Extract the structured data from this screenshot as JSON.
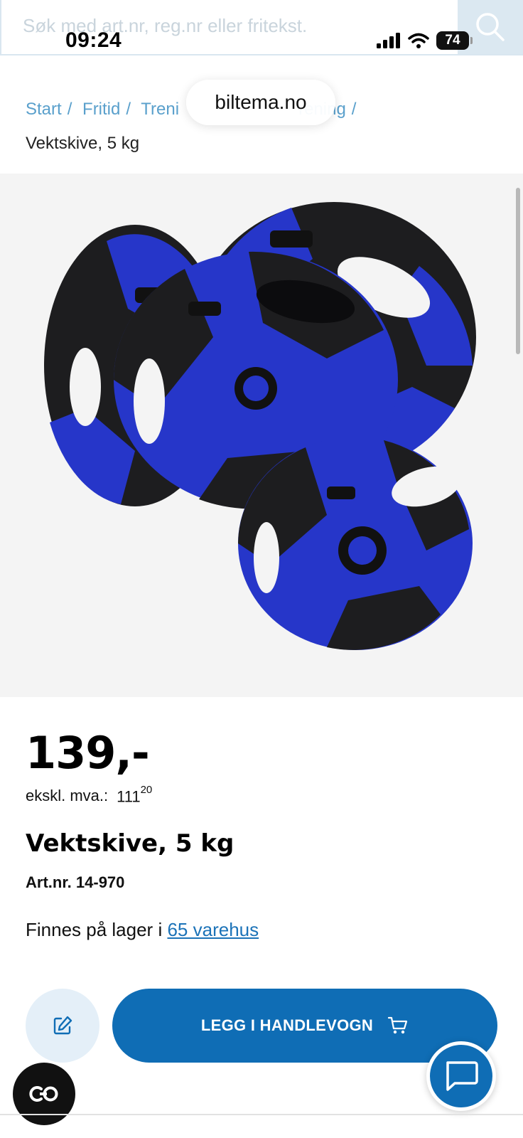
{
  "status_bar": {
    "time": "09:24",
    "battery": "74"
  },
  "search": {
    "placeholder": "Søk med art.nr, reg.nr eller fritekst."
  },
  "browser": {
    "domain": "biltema.no"
  },
  "breadcrumb": {
    "items": [
      {
        "label": "Start"
      },
      {
        "label": "Fritid"
      },
      {
        "label": "Treni"
      },
      {
        "label": "rening"
      }
    ],
    "current": "Vektskive, 5 kg"
  },
  "product": {
    "price": "139,-",
    "ex_vat_label": "ekskl. mva.:",
    "ex_vat_whole": "111",
    "ex_vat_decimals": "20",
    "name": "Vektskive, 5 kg",
    "art_nr": "Art.nr. 14-970",
    "stock_text": "Finnes på lager i",
    "stock_link": "65 varehus"
  },
  "actions": {
    "add_to_cart_label": "LEGG I HANDLEVOGN"
  },
  "colors": {
    "primary": "#0f6db5",
    "link": "#5aa0cc",
    "plate_blue": "#2636c9",
    "plate_black": "#1d1d1f"
  },
  "icons": {
    "search": "search-icon",
    "note": "edit-icon",
    "cart": "cart-icon",
    "chat": "chat-icon",
    "co": "co-icon"
  }
}
